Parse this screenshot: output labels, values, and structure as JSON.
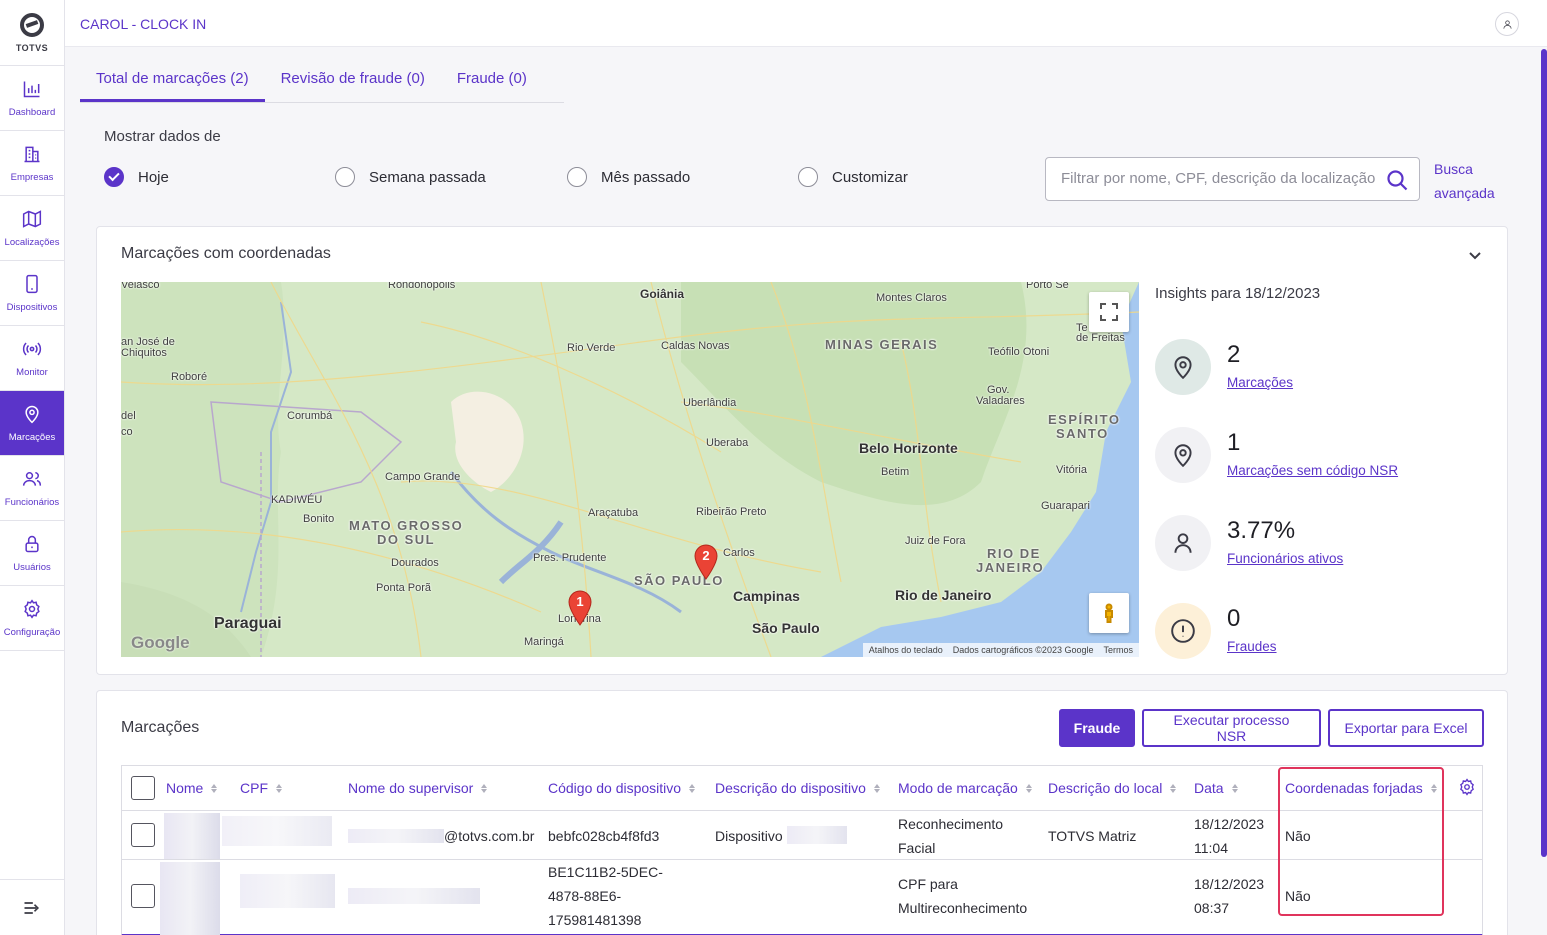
{
  "brand": {
    "name": "TOTVS"
  },
  "sidebar": {
    "items": [
      {
        "label": "Dashboard",
        "icon": "bar-chart-icon",
        "active": false
      },
      {
        "label": "Empresas",
        "icon": "building-icon",
        "active": false
      },
      {
        "label": "Localizações",
        "icon": "map-icon",
        "active": false
      },
      {
        "label": "Dispositivos",
        "icon": "smartphone-icon",
        "active": false
      },
      {
        "label": "Monitor",
        "icon": "broadcast-icon",
        "active": false
      },
      {
        "label": "Marcações",
        "icon": "map-pin-icon",
        "active": true
      },
      {
        "label": "Funcionários",
        "icon": "users-icon",
        "active": false
      },
      {
        "label": "Usuários",
        "icon": "lock-icon",
        "active": false
      },
      {
        "label": "Configuração",
        "icon": "gear-icon",
        "active": false
      }
    ]
  },
  "header": {
    "title": "CAROL - CLOCK IN"
  },
  "tabs": [
    {
      "label": "Total de marcações (2)",
      "active": true
    },
    {
      "label": "Revisão de fraude (0)",
      "active": false
    },
    {
      "label": "Fraude (0)",
      "active": false
    }
  ],
  "filters": {
    "title": "Mostrar dados de",
    "options": [
      {
        "label": "Hoje",
        "checked": true
      },
      {
        "label": "Semana passada",
        "checked": false
      },
      {
        "label": "Mês passado",
        "checked": false
      },
      {
        "label": "Customizar",
        "checked": false
      }
    ],
    "search_placeholder": "Filtrar por nome, CPF, descrição da localização",
    "advanced_search": "Busca avançada"
  },
  "map_section": {
    "title": "Marcações com coordenadas",
    "map_labels": {
      "goiania": "Goiânia",
      "montes_claros": "Montes Claros",
      "minas_gerais": "MINAS GERAIS",
      "rondonopolis": "Rondonópolis",
      "rio_verde": "Rio Verde",
      "caldas_novas": "Caldas Novas",
      "teofilo_otoni": "Teófilo Otoni",
      "san_jose": "an José de",
      "chiquitos": "Chiquitos",
      "robore": "Roboré",
      "corumba": "Corumbá",
      "uberlandia": "Uberlândia",
      "gov_valadares_1": "Gov.",
      "gov_valadares_2": "Valadares",
      "espirito_1": "ESPÍRITO",
      "espirito_2": "SANTO",
      "uberaba": "Uberaba",
      "belo_horizonte": "Belo Horizonte",
      "betim": "Betim",
      "vitoria": "Vitória",
      "campo_grande": "Campo Grande",
      "kadiweu": "KADIWÉU",
      "bonito": "Bonito",
      "ms_1": "MATO GROSSO",
      "ms_2": "DO SUL",
      "aracatuba": "Araçatuba",
      "ribeirao_preto": "Ribeirão Preto",
      "guarapari": "Guarapari",
      "juiz_de_fora": "Juiz de Fora",
      "rj_1": "RIO DE",
      "rj_2": "JANEIRO",
      "pres_prudente": "Pres. Prudente",
      "sao_carlos": "Carlos",
      "sao_paulo_state": "SÃO PAULO",
      "dourados": "Dourados",
      "ponta_pora": "Ponta Porã",
      "campinas": "Campinas",
      "rio_de_janeiro": "Rio de Janeiro",
      "paraguai": "Paraguai",
      "sao_paulo": "São Paulo",
      "londrina": "Londrina",
      "maringa": "Maringá",
      "velasco": "Velasco",
      "porto_se": "Porto Se",
      "de_freitas": "de Freitas",
      "del": "del",
      "co": "co",
      "te": "Te"
    },
    "markers": [
      {
        "label": "1"
      },
      {
        "label": "2"
      }
    ],
    "google": "Google",
    "attribution": {
      "shortcuts": "Atalhos do teclado",
      "data": "Dados cartográficos ©2023 Google",
      "terms": "Termos"
    }
  },
  "insights": {
    "title": "Insights para 18/12/2023",
    "items": [
      {
        "value": "2",
        "label": "Marcações",
        "icon": "map-pin-icon",
        "bg": "#dfe9e6"
      },
      {
        "value": "1",
        "label": "Marcações sem código NSR",
        "icon": "map-pin-icon",
        "bg": "#f1f1f4"
      },
      {
        "value": "3.77%",
        "label": "Funcionários ativos",
        "icon": "user-icon",
        "bg": "#f1f1f4"
      },
      {
        "value": "0",
        "label": "Fraudes",
        "icon": "alert-circle-icon",
        "bg": "#fdf0d8"
      }
    ]
  },
  "table_section": {
    "title": "Marcações",
    "buttons": {
      "fraud": "Fraude",
      "nsr": "Executar processo NSR",
      "excel": "Exportar para Excel"
    },
    "columns": [
      "Nome",
      "CPF",
      "Nome do supervisor",
      "Código do dispositivo",
      "Descrição do dispositivo",
      "Modo de marcação",
      "Descrição do local",
      "Data",
      "Coordenadas forjadas"
    ],
    "rows": [
      {
        "supervisor": "@totvs.com.br",
        "device_code": "bebfc028cb4f8fd3",
        "device_desc": "Dispositivo",
        "mode": [
          "Reconhecimento",
          "Facial"
        ],
        "location": "TOTVS Matriz",
        "date": [
          "18/12/2023",
          "11:04"
        ],
        "forged": "Não"
      },
      {
        "supervisor": "",
        "device_code": [
          "BE1C11B2-5DEC-",
          "4878-88E6-",
          "175981481398"
        ],
        "device_desc": "",
        "mode": [
          "CPF para",
          "Multireconhecimento"
        ],
        "location": "",
        "date": [
          "18/12/2023",
          "08:37"
        ],
        "forged": "Não"
      }
    ]
  },
  "colors": {
    "accent": "#5b34c9",
    "highlight": "#e0345c",
    "water": "#a6c8f0",
    "land": "#d5e8c6"
  }
}
